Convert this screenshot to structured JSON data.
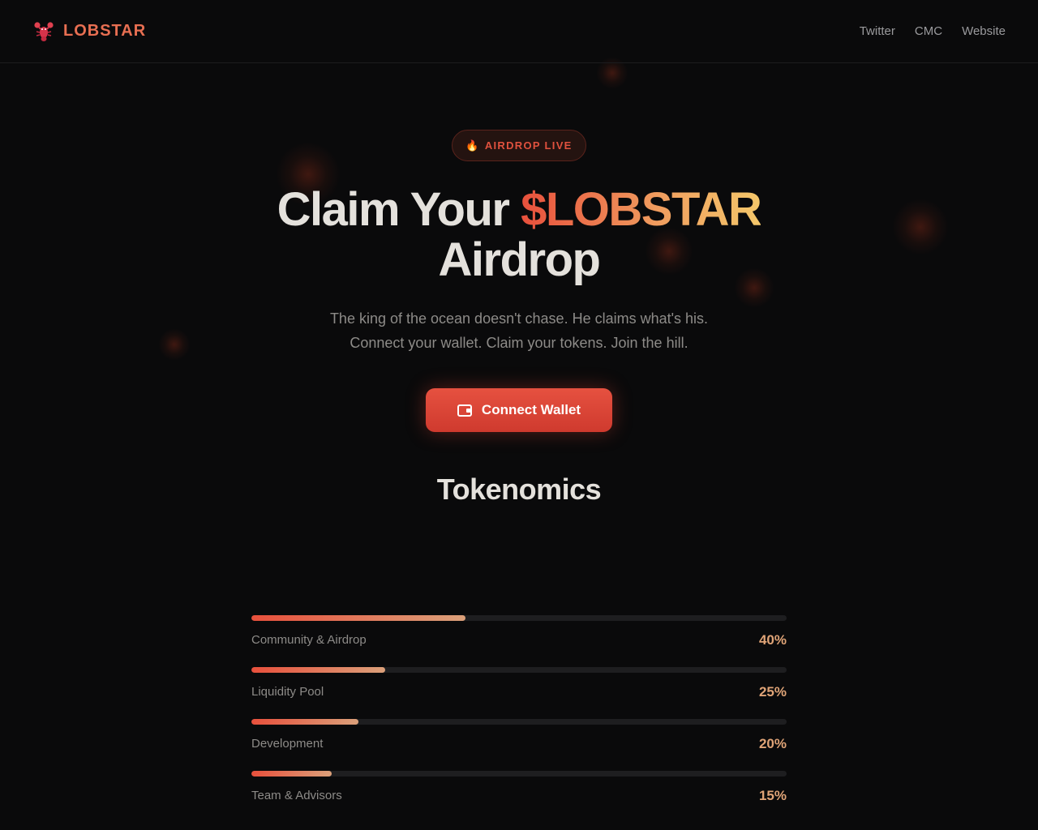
{
  "brand": {
    "name": "LOBSTAR",
    "logo_icon": "lobster-icon",
    "color": "#e86f52"
  },
  "nav": [
    {
      "label": "Twitter"
    },
    {
      "label": "CMC"
    },
    {
      "label": "Website"
    }
  ],
  "hero": {
    "badge": {
      "icon": "fire-icon",
      "icon_glyph": "🔥",
      "label": "AIRDROP LIVE"
    },
    "title_prefix": "Claim Your ",
    "title_accent": "$LOBSTAR",
    "title_suffix": "Airdrop",
    "subtitle_line1": "The king of the ocean doesn't chase. He claims what's his.",
    "subtitle_line2": "Connect your wallet. Claim your tokens. Join the hill.",
    "cta": {
      "label": "Connect Wallet",
      "icon": "wallet-icon"
    }
  },
  "tokenomics": {
    "heading": "Tokenomics",
    "items": [
      {
        "label": "Community & Airdrop",
        "value": "40%",
        "percent": 40
      },
      {
        "label": "Liquidity Pool",
        "value": "25%",
        "percent": 25
      },
      {
        "label": "Development",
        "value": "20%",
        "percent": 20
      },
      {
        "label": "Team & Advisors",
        "value": "15%",
        "percent": 15
      }
    ]
  },
  "colors": {
    "accent": "#e8503c",
    "accent_gold": "#f4c76a",
    "background": "#0a0a0b"
  }
}
